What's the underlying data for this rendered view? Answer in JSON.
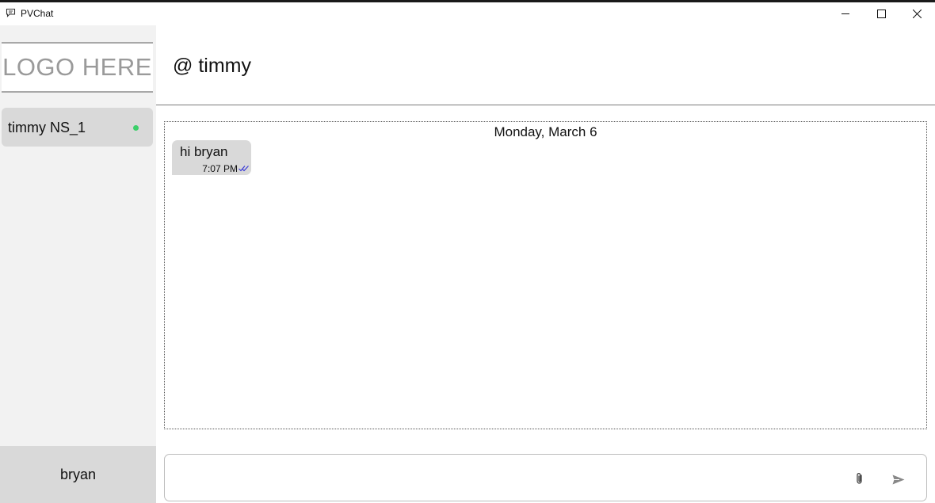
{
  "window": {
    "title": "PVChat",
    "icons": [
      "chat-icon",
      "minimize-icon",
      "maximize-icon",
      "close-icon"
    ]
  },
  "sidebar": {
    "logo_text": "LOGO HERE",
    "contacts": [
      {
        "label": "timmy NS_1",
        "status": "online"
      }
    ],
    "current_user": "bryan"
  },
  "chat": {
    "title": "@ timmy",
    "date_separator": "Monday, March 6",
    "messages": [
      {
        "text": "hi bryan",
        "time": "7:07 PM",
        "status_icon": "double-check-icon"
      }
    ]
  },
  "composer": {
    "placeholder": "",
    "value": ""
  },
  "colors": {
    "online": "#3ccf6a",
    "bubble": "#d9d9d9",
    "sidebar_bg": "#f2f2f2",
    "read_check": "#3b3bd6"
  }
}
